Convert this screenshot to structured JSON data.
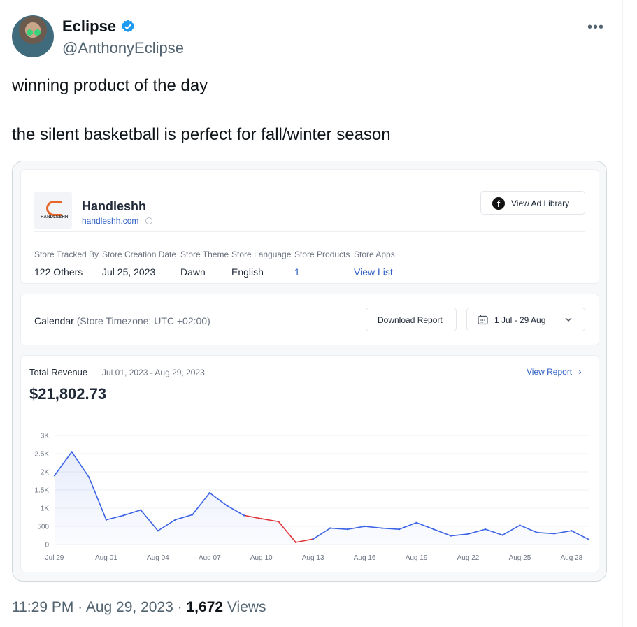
{
  "tweet": {
    "author_name": "Eclipse",
    "author_handle": "@AnthonyEclipse",
    "more_label": "•••",
    "text_line1": "winning product of the day",
    "text_line2": "the silent basketball is perfect for fall/winter season",
    "time": "11:29 PM",
    "separator": "·",
    "date": "Aug 29, 2023",
    "views_count": "1,672",
    "views_label": "Views"
  },
  "store": {
    "logo_text": "HANDLESHH",
    "name": "Handleshh",
    "url": "handleshh.com",
    "ad_library_label": "View Ad Library",
    "meta": [
      {
        "label": "Store Tracked By",
        "value": "122 Others"
      },
      {
        "label": "Store Creation Date",
        "value": "Jul 25, 2023"
      },
      {
        "label": "Store Theme",
        "value": "Dawn"
      },
      {
        "label": "Store Language",
        "value": "English"
      },
      {
        "label": "Store Products",
        "value": "1"
      },
      {
        "label": "Store Apps",
        "value": "View List"
      }
    ]
  },
  "calendar": {
    "label": "Calendar",
    "timezone": "(Store Timezone: UTC +02:00)",
    "download_label": "Download Report",
    "range_label": "1 Jul - 29 Aug",
    "calendar_icon": "calendar-icon",
    "chevron_icon": "chevron-down-icon"
  },
  "revenue": {
    "title": "Total Revenue",
    "range": "Jul 01, 2023 - Aug 29, 2023",
    "view_report_label": "View Report",
    "total": "$21,802.73"
  },
  "colors": {
    "line": "#3b63e6",
    "drop": "#e0343a",
    "link": "#2f5fc4",
    "verified": "#1d9bf0"
  },
  "chart_data": {
    "type": "line",
    "title": "",
    "xlabel": "",
    "ylabel": "",
    "ylim": [
      0,
      3000
    ],
    "y_ticks": [
      "0",
      "500",
      "1K",
      "1.5K",
      "2K",
      "2.5K",
      "3K"
    ],
    "y_tick_values": [
      0,
      500,
      1000,
      1500,
      2000,
      2500,
      3000
    ],
    "x_tick_labels": [
      "Jul 29",
      "Aug 01",
      "Aug 04",
      "Aug 07",
      "Aug 10",
      "Aug 13",
      "Aug 16",
      "Aug 19",
      "Aug 22",
      "Aug 25",
      "Aug 28"
    ],
    "x": [
      "Jul 29",
      "Jul 30",
      "Jul 31",
      "Aug 01",
      "Aug 02",
      "Aug 03",
      "Aug 04",
      "Aug 05",
      "Aug 06",
      "Aug 07",
      "Aug 08",
      "Aug 09",
      "Aug 10",
      "Aug 11",
      "Aug 12",
      "Aug 13",
      "Aug 14",
      "Aug 15",
      "Aug 16",
      "Aug 17",
      "Aug 18",
      "Aug 19",
      "Aug 20",
      "Aug 21",
      "Aug 22",
      "Aug 23",
      "Aug 24",
      "Aug 25",
      "Aug 26",
      "Aug 27",
      "Aug 28",
      "Aug 29"
    ],
    "series": [
      {
        "values": [
          1900,
          2550,
          1850,
          680,
          800,
          950,
          380,
          680,
          820,
          1420,
          1070,
          800,
          710,
          630,
          60,
          150,
          450,
          420,
          500,
          450,
          420,
          600,
          420,
          240,
          290,
          420,
          260,
          530,
          330,
          300,
          380,
          140
        ],
        "highlight_segment": [
          11,
          15
        ]
      }
    ],
    "grid": true,
    "legend": "none"
  }
}
